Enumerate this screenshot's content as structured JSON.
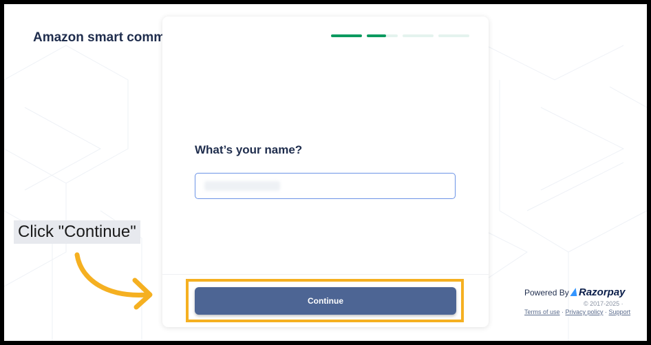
{
  "background": {
    "title": "Amazon smart comm"
  },
  "progress": {
    "segments": [
      {
        "state": "complete",
        "color": "#0a9a5f"
      },
      {
        "state": "partial",
        "color": "#0a9a5f"
      },
      {
        "state": "pending",
        "color": "#e4f3ee"
      },
      {
        "state": "pending",
        "color": "#e4f3ee"
      }
    ]
  },
  "form": {
    "question": "What’s your name?",
    "name_value": ""
  },
  "actions": {
    "continue_label": "Continue"
  },
  "annotation": {
    "callout_text": "Click \"Continue\"",
    "highlight_color": "#f5b021"
  },
  "footer": {
    "powered_by": "Powered By",
    "brand": "Razorpay",
    "copyright": "© 2017-2025 ·",
    "terms": "Terms of use",
    "privacy": "Privacy policy",
    "support": "Support",
    "separator": " · "
  },
  "colors": {
    "accent": "#4d6594",
    "text": "#1f2d4d",
    "input_border": "#6b93e6"
  }
}
